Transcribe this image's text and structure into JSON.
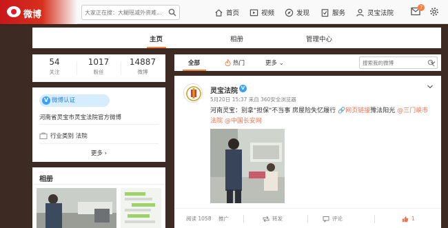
{
  "header": {
    "logo_text": "微博",
    "search_placeholder": "大家正在搜：大糊瑶减外资难...",
    "nav": [
      {
        "label": "首页",
        "icon": "home-icon"
      },
      {
        "label": "视频",
        "icon": "video-icon"
      },
      {
        "label": "发现",
        "icon": "discover-icon"
      },
      {
        "label": "服务",
        "icon": "service-icon"
      },
      {
        "label": "灵宝法院",
        "icon": "user-icon"
      }
    ],
    "message_badge": "7"
  },
  "tabs": {
    "items": [
      "主页",
      "相册",
      "管理中心"
    ],
    "active": "主页"
  },
  "stats": [
    {
      "num": "54",
      "label": "关注"
    },
    {
      "num": "1017",
      "label": "粉丝"
    },
    {
      "num": "14887",
      "label": "微博"
    }
  ],
  "info": {
    "verify_label": "微博认证",
    "description": "河南省灵宝市灵宝法院官方微博",
    "industry": "行业类别 法院",
    "more_label": "更多"
  },
  "album": {
    "title": "相册"
  },
  "feed_tabs": {
    "all": "全部",
    "hot": "热门",
    "more": "更多",
    "search_placeholder": "搜索我的微博"
  },
  "post": {
    "author": "灵宝法院",
    "meta": "5月20日 15:37 来自 360安全浏览器",
    "text_main": "河南灵宝：别拿\"担保\"不当事 房屋险失忆履行 ",
    "link_label": "网页链接",
    "text_after": "豫法阳光 ",
    "mention1": "@三门峡市法院",
    "mention2": "@中国长安网",
    "footer": {
      "read": "阅读 1058",
      "promote": "推广",
      "forward": "转发",
      "comment": "评论",
      "like": "1"
    }
  },
  "colors": {
    "accent": "#fa7d3c",
    "brand_red": "#e6162d",
    "link": "#eb7350",
    "verify_blue": "#3aa0ff"
  }
}
